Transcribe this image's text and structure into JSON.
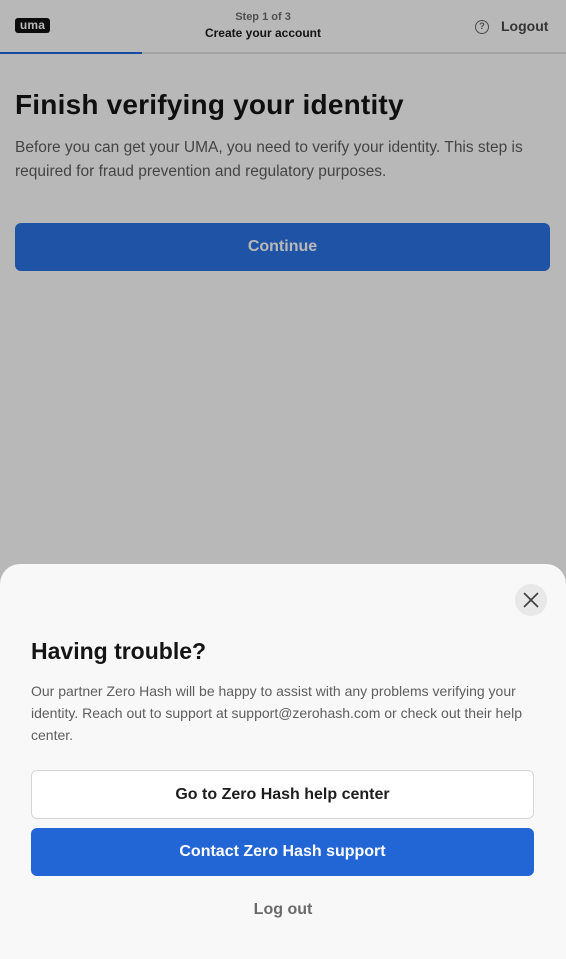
{
  "header": {
    "logo_text": "uma",
    "step_count": "Step 1 of 3",
    "step_title": "Create your account",
    "help_icon_glyph": "?",
    "logout_label": "Logout",
    "progress": 0.25
  },
  "main": {
    "title": "Finish verifying your identity",
    "description": "Before you can get your UMA, you need to verify your identity. This step is required for fraud prevention and regulatory purposes.",
    "continue_label": "Continue"
  },
  "sheet": {
    "title": "Having trouble?",
    "description": "Our partner Zero Hash will be happy to assist with any problems verifying your identity. Reach out to support at support@zerohash.com or check out their help center.",
    "help_center_label": "Go to Zero Hash help center",
    "support_label": "Contact Zero Hash support",
    "logout_label": "Log out"
  },
  "icons": {
    "help": "help-circle-icon",
    "close": "close-icon"
  },
  "colors": {
    "primary": "#2266d6",
    "progress": "#1a6ae0",
    "overlay": "rgba(0,0,0,0.28)"
  }
}
